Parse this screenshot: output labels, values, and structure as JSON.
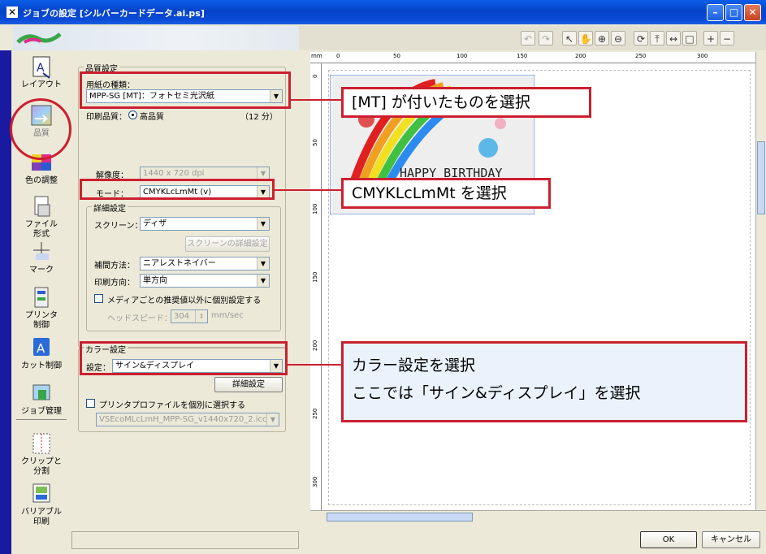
{
  "window": {
    "title": "ジョブの設定 [シルバーカードデータ.ai.ps]",
    "controls": [
      "minimize",
      "maximize",
      "close"
    ]
  },
  "sidebar": {
    "items": [
      {
        "label": "レイアウト",
        "icon": "layout-icon"
      },
      {
        "label": "品質",
        "icon": "quality-icon"
      },
      {
        "label": "色の調整",
        "icon": "color-adjust-icon"
      },
      {
        "label": "ファイル\n形式",
        "icon": "file-format-icon"
      },
      {
        "label": "マーク",
        "icon": "mark-icon"
      },
      {
        "label": "プリンタ\n制御",
        "icon": "printer-control-icon"
      },
      {
        "label": "カット制御",
        "icon": "cut-control-icon"
      },
      {
        "label": "ジョブ管理",
        "icon": "job-management-icon"
      },
      {
        "label": "クリップと\n分割",
        "icon": "clip-split-icon"
      },
      {
        "label": "バリアブル\n印刷",
        "icon": "variable-print-icon"
      }
    ]
  },
  "quality": {
    "group_title": "品質設定",
    "paper_type_label": "用紙の種類：",
    "paper_type_value": "MPP-SG [MT]：フォトセミ光沢紙",
    "print_quality_label": "印刷品質：",
    "print_quality_value": "高品質",
    "print_time": "（12 分）",
    "resolution_label": "解像度：",
    "resolution_value": "1440 x 720 dpi",
    "mode_label": "モード：",
    "mode_value": "CMYKLcLmMt (v)",
    "detail_group_title": "詳細設定",
    "screen_label": "スクリーン：",
    "screen_value": "ディザ",
    "screen_detail_button": "スクリーンの詳細設定",
    "interpolation_label": "補間方法：",
    "interpolation_value": "ニアレストネイバー",
    "print_direction_label": "印刷方向：",
    "print_direction_value": "単方向",
    "media_checkbox_label": "メディアごとの推奨値以外に個別設定する",
    "head_speed_label": "ヘッドスピード：",
    "head_speed_value": "304",
    "head_speed_unit": "mm/sec"
  },
  "color": {
    "group_title": "カラー設定",
    "setting_label": "設定：",
    "setting_value": "サイン&ディスプレイ",
    "detail_button": "詳細設定",
    "profile_checkbox_label": "プリンタプロファイルを個別に選択する",
    "profile_value": "VSEcoMLcLmH_MPP-SG_v1440x720_2.icc"
  },
  "callouts": {
    "paper": "[MT] が付いたものを選択",
    "mode": "CMYKLcLmMt を選択",
    "color_line1": "カラー設定を選択",
    "color_line2": "ここでは「サイン&ディスプレイ」を選択"
  },
  "preview": {
    "ruler_unit": "mm",
    "ruler_h": [
      "0",
      "50",
      "100",
      "150",
      "200",
      "250",
      "300"
    ],
    "ruler_v": [
      "0",
      "50",
      "100",
      "150",
      "200",
      "250",
      "300"
    ],
    "card_text": "HAPPY BIRTHDAY"
  },
  "footer": {
    "ok": "OK",
    "cancel": "キャンセル"
  },
  "colors": {
    "title_bar": "#0a4ad6",
    "annotation_red": "#cc1f2f",
    "callout_fill": "#eaf3fc"
  }
}
